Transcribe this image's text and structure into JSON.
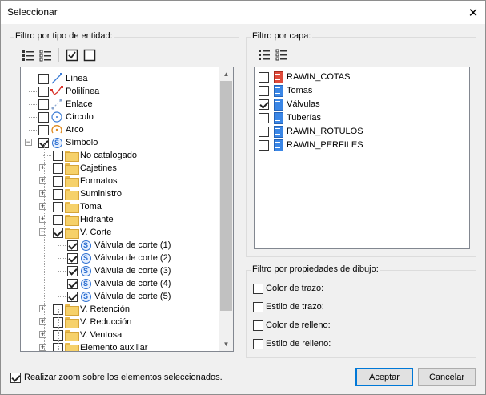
{
  "window": {
    "title": "Seleccionar",
    "close_icon": "close-icon"
  },
  "entity_filter": {
    "label": "Filtro por tipo de entidad:",
    "toolbar": [
      "expand-all-icon",
      "collapse-all-icon",
      "check-all-icon",
      "uncheck-all-icon"
    ],
    "items": [
      {
        "label": "Línea",
        "checked": false,
        "icon": "line-icon"
      },
      {
        "label": "Polilínea",
        "checked": false,
        "icon": "polyline-icon"
      },
      {
        "label": "Enlace",
        "checked": false,
        "icon": "link-icon"
      },
      {
        "label": "Círculo",
        "checked": false,
        "icon": "circle-icon"
      },
      {
        "label": "Arco",
        "checked": false,
        "icon": "arc-icon"
      },
      {
        "label": "Símbolo",
        "checked": true,
        "icon": "symbol-icon"
      },
      {
        "label": "No catalogado",
        "checked": false,
        "icon": "folder-icon"
      },
      {
        "label": "Cajetines",
        "checked": false,
        "icon": "folder-icon"
      },
      {
        "label": "Formatos",
        "checked": false,
        "icon": "folder-icon"
      },
      {
        "label": "Suministro",
        "checked": false,
        "icon": "folder-icon"
      },
      {
        "label": "Toma",
        "checked": false,
        "icon": "folder-icon"
      },
      {
        "label": "Hidrante",
        "checked": false,
        "icon": "folder-icon"
      },
      {
        "label": "V. Corte",
        "checked": true,
        "icon": "folder-open-icon"
      },
      {
        "label": "Válvula de corte (1)",
        "checked": true,
        "icon": "symbol-icon"
      },
      {
        "label": "Válvula de corte (2)",
        "checked": true,
        "icon": "symbol-icon"
      },
      {
        "label": "Válvula de corte (3)",
        "checked": true,
        "icon": "symbol-icon"
      },
      {
        "label": "Válvula de corte (4)",
        "checked": true,
        "icon": "symbol-icon"
      },
      {
        "label": "Válvula de corte (5)",
        "checked": true,
        "icon": "symbol-icon"
      },
      {
        "label": "V. Retención",
        "checked": false,
        "icon": "folder-icon"
      },
      {
        "label": "V. Reducción",
        "checked": false,
        "icon": "folder-icon"
      },
      {
        "label": "V. Ventosa",
        "checked": false,
        "icon": "folder-icon"
      },
      {
        "label": "Elemento auxiliar",
        "checked": false,
        "icon": "folder-icon"
      }
    ]
  },
  "layer_filter": {
    "label": "Filtro por capa:",
    "toolbar": [
      "expand-all-icon",
      "collapse-all-icon"
    ],
    "items": [
      {
        "label": "RAWIN_COTAS",
        "checked": false,
        "icon": "layer-red-icon"
      },
      {
        "label": "Tomas",
        "checked": false,
        "icon": "layer-blue-icon"
      },
      {
        "label": "Válvulas",
        "checked": true,
        "icon": "layer-blue-icon"
      },
      {
        "label": "Tuberías",
        "checked": false,
        "icon": "layer-blue-icon"
      },
      {
        "label": "RAWIN_ROTULOS",
        "checked": false,
        "icon": "layer-blue-icon"
      },
      {
        "label": "RAWIN_PERFILES",
        "checked": false,
        "icon": "layer-blue-icon"
      }
    ]
  },
  "drawing_filter": {
    "label": "Filtro por propiedades de dibujo:",
    "items": [
      {
        "label": "Color de trazo:",
        "checked": false
      },
      {
        "label": "Estilo de trazo:",
        "checked": false
      },
      {
        "label": "Color de relleno:",
        "checked": false
      },
      {
        "label": "Estilo de relleno:",
        "checked": false
      }
    ]
  },
  "footer": {
    "zoom_label": "Realizar zoom sobre los elementos seleccionados.",
    "zoom_checked": true,
    "accept": "Aceptar",
    "cancel": "Cancelar"
  },
  "colors": {
    "accent": "#0078d7",
    "folder": "#f6d16a",
    "symbol": "#2c6fd1",
    "layer_blue": "#3a86e6",
    "layer_red": "#e04a3a"
  }
}
